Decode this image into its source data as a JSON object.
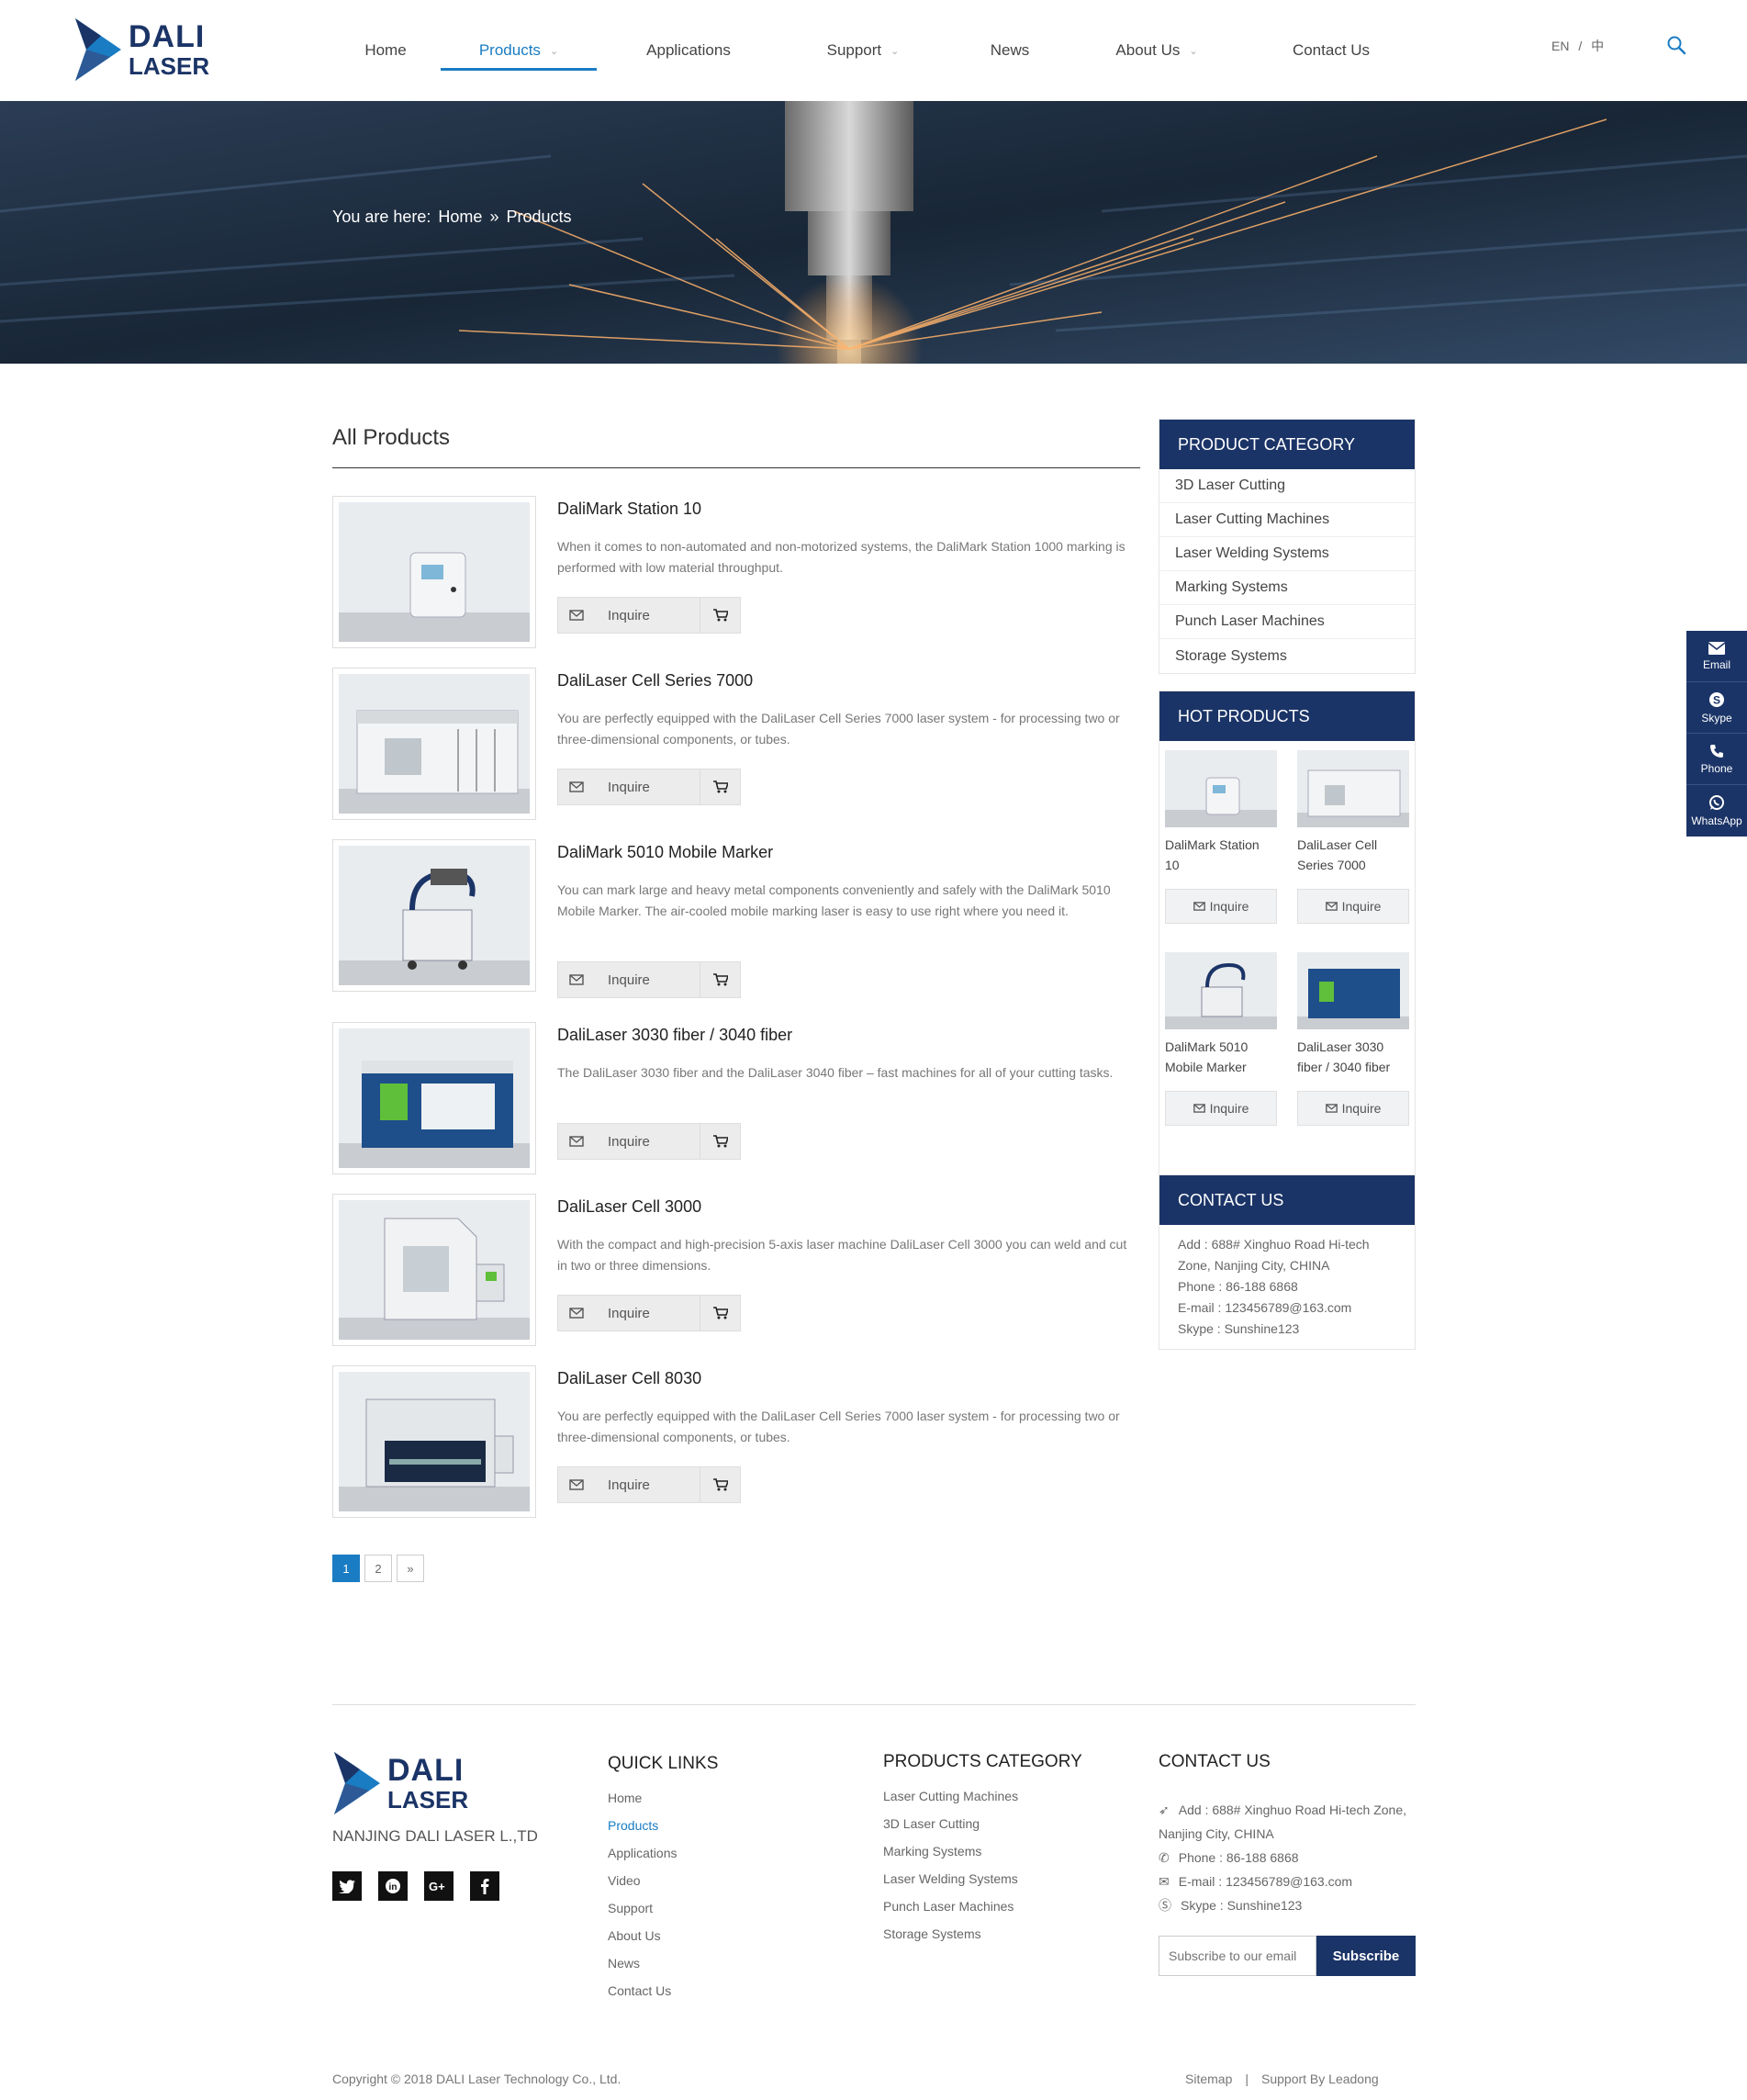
{
  "brand": {
    "name_line1": "DALI",
    "name_line2": "LASER",
    "color": "#1b3467",
    "accent": "#1a7cc3"
  },
  "nav": [
    {
      "label": "Home",
      "active": false,
      "dropdown": false
    },
    {
      "label": "Products",
      "active": true,
      "dropdown": true
    },
    {
      "label": "Applications",
      "active": false,
      "dropdown": false
    },
    {
      "label": "Support",
      "active": false,
      "dropdown": true
    },
    {
      "label": "News",
      "active": false,
      "dropdown": false
    },
    {
      "label": "About Us",
      "active": false,
      "dropdown": true
    },
    {
      "label": "Contact Us",
      "active": false,
      "dropdown": false
    }
  ],
  "lang": {
    "en": "EN",
    "sep": "/",
    "other": "中"
  },
  "breadcrumb": {
    "prefix": "You are here:",
    "home": "Home",
    "sep": "»",
    "current": "Products"
  },
  "main": {
    "title": "All Products"
  },
  "products": [
    {
      "name": "DaliMark Station 10",
      "desc": "When it comes to non-automated and non-motorized systems, the DaliMark Station 1000 marking is performed with low material throughput.",
      "inquire": "Inquire"
    },
    {
      "name": "DaliLaser Cell Series 7000",
      "desc": "You are perfectly equipped with the DaliLaser Cell Series 7000 laser system - for processing two or three-dimensional components, or tubes.",
      "inquire": "Inquire"
    },
    {
      "name": "DaliMark 5010 Mobile Marker",
      "desc": "You can mark large and heavy metal components conveniently and safely with the DaliMark 5010 Mobile Marker. The air-cooled mobile marking laser is easy to use right where you need it.",
      "inquire": "Inquire"
    },
    {
      "name": "DaliLaser 3030 fiber / 3040 fiber",
      "desc": "The DaliLaser 3030 fiber and the DaliLaser 3040 fiber – fast machines for all of your cutting tasks.",
      "inquire": "Inquire"
    },
    {
      "name": "DaliLaser Cell 3000",
      "desc": "With the compact and high-precision 5-axis laser machine DaliLaser Cell 3000 you can weld and cut in two or three dimensions.",
      "inquire": "Inquire"
    },
    {
      "name": "DaliLaser Cell 8030",
      "desc": "You are perfectly equipped with the DaliLaser Cell Series 7000 laser system - for processing two or three-dimensional components, or tubes.",
      "inquire": "Inquire"
    }
  ],
  "pagination": {
    "pages": [
      "1",
      "2"
    ],
    "next": "»",
    "current": "1"
  },
  "sidebar": {
    "category_title": "PRODUCT CATEGORY",
    "categories": [
      "3D Laser Cutting",
      "Laser Cutting Machines",
      "Laser Welding Systems",
      "Marking Systems",
      "Punch Laser Machines",
      "Storage Systems"
    ],
    "hot_title": "HOT PRODUCTS",
    "hot": [
      {
        "name": "DaliMark Station 10",
        "btn": "Inquire"
      },
      {
        "name": "DaliLaser Cell Series 7000",
        "btn": "Inquire"
      },
      {
        "name": "DaliMark 5010 Mobile Marker",
        "btn": "Inquire"
      },
      {
        "name": "DaliLaser 3030 fiber / 3040 fiber",
        "btn": "Inquire"
      }
    ],
    "contact_title": "CONTACT US",
    "contact": {
      "add": "Add : 688# Xinghuo Road Hi-tech Zone, Nanjing City, CHINA",
      "phone": "Phone : 86-188 6868",
      "email": "E-mail : 123456789@163.com",
      "skype": "Skype : Sunshine123"
    }
  },
  "float_bar": [
    {
      "label": "Email",
      "icon": "envelope-icon"
    },
    {
      "label": "Skype",
      "icon": "skype-icon"
    },
    {
      "label": "Phone",
      "icon": "phone-icon"
    },
    {
      "label": "WhatsApp",
      "icon": "whatsapp-icon"
    }
  ],
  "footer": {
    "company": "NANJING DALI LASER L.,TD",
    "social": [
      "twitter-icon",
      "linkedin-icon",
      "google-plus-icon",
      "facebook-icon"
    ],
    "quick_title": "QUICK LINKS",
    "quick_links": [
      "Home",
      "Products",
      "Applications",
      "Video",
      "Support",
      "About Us",
      "News",
      "Contact Us"
    ],
    "cat_title": "PRODUCTS CATEGORY",
    "cat_links": [
      "Laser Cutting Machines",
      "3D Laser Cutting",
      "Marking Systems",
      "Laser Welding Systems",
      "Punch Laser Machines",
      "Storage Systems"
    ],
    "contact_title": "CONTACT US",
    "contact": {
      "add": "Add : 688# Xinghuo Road Hi-tech Zone, Nanjing City, CHINA",
      "phone": "Phone : 86-188 6868",
      "email": "E-mail : 123456789@163.com",
      "skype": "Skype : Sunshine123"
    },
    "subscribe_placeholder": "Subscribe to our email",
    "subscribe_btn": "Subscribe",
    "copyright": "Copyright © 2018  DALI Laser Technology Co., Ltd.",
    "sitemap": "Sitemap",
    "sep": "|",
    "support": "Support By Leadong"
  }
}
